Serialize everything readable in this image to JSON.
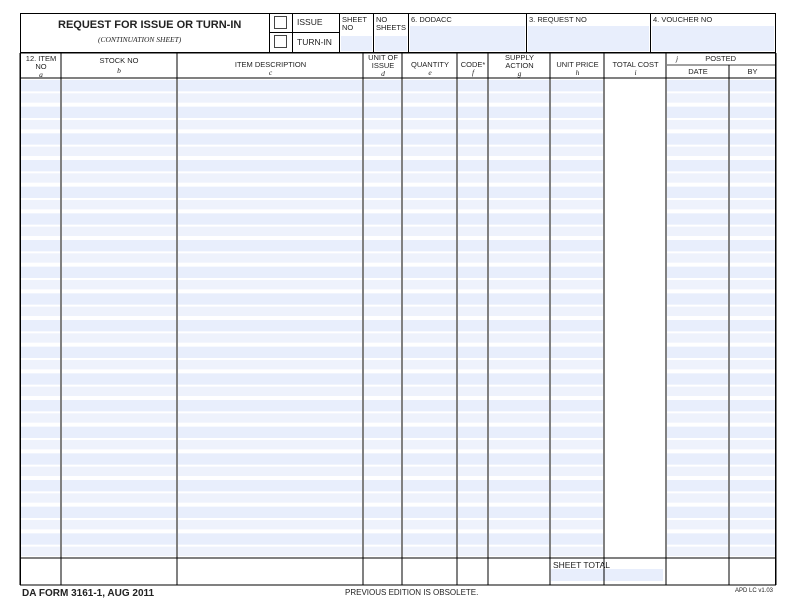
{
  "form": {
    "title": "REQUEST FOR ISSUE OR TURN-IN",
    "subtitle": "(CONTINUATION SHEET)",
    "issue_label": "ISSUE",
    "turnin_label": "TURN-IN",
    "sheet_no_label": "SHEET NO",
    "no_sheets_label": "NO SHEETS",
    "dodacc_label": "6. DODACC",
    "request_no_label": "3. REQUEST NO",
    "voucher_no_label": "4. VOUCHER NO",
    "form_number": "DA FORM 3161-1, AUG 2011",
    "previous_edition": "PREVIOUS EDITION IS OBSOLETE.",
    "apd": "APD LC v1.03",
    "sheet_total_label": "SHEET TOTAL"
  },
  "columns": [
    {
      "id": "item_no",
      "label1": "12. ITEM",
      "label2": "NO",
      "letter": "a"
    },
    {
      "id": "stock_no",
      "label1": "STOCK NO",
      "label2": "",
      "letter": "b"
    },
    {
      "id": "item_desc",
      "label1": "ITEM DESCRIPTION",
      "label2": "",
      "letter": "c"
    },
    {
      "id": "unit_issue",
      "label1": "UNIT OF",
      "label2": "ISSUE",
      "letter": "d"
    },
    {
      "id": "quantity",
      "label1": "QUANTITY",
      "label2": "",
      "letter": "e"
    },
    {
      "id": "code",
      "label1": "CODE*",
      "label2": "",
      "letter": "f"
    },
    {
      "id": "supply_action",
      "label1": "SUPPLY",
      "label2": "ACTION",
      "letter": "g"
    },
    {
      "id": "unit_price",
      "label1": "UNIT PRICE",
      "label2": "",
      "letter": "h"
    },
    {
      "id": "total_cost",
      "label1": "TOTAL COST",
      "label2": "",
      "letter": "i"
    },
    {
      "id": "posted",
      "label1": "POSTED",
      "label2": "",
      "letter": "j"
    },
    {
      "id": "date",
      "label1": "DATE",
      "label2": "",
      "letter": ""
    },
    {
      "id": "by",
      "label1": "BY",
      "label2": "",
      "letter": ""
    }
  ],
  "row_count": 18
}
